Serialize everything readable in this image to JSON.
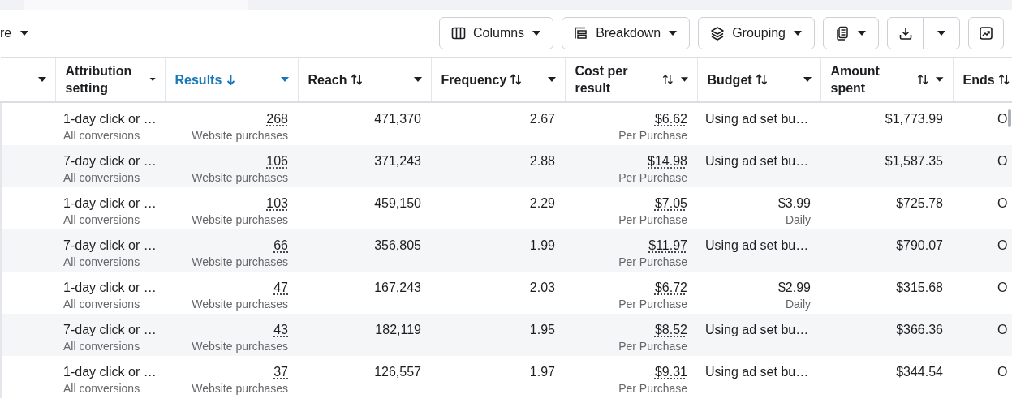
{
  "toolbar": {
    "left_menu": {
      "label": "re"
    },
    "buttons": [
      {
        "kind": "dropdown",
        "label": "Columns"
      },
      {
        "kind": "dropdown",
        "label": "Breakdown"
      },
      {
        "kind": "dropdown",
        "label": "Grouping"
      },
      {
        "kind": "dropdown"
      },
      {
        "kind": "split"
      },
      {
        "kind": "icon"
      }
    ]
  },
  "table": {
    "columns": [
      {
        "sortable": false,
        "selected": false
      },
      {
        "label": "Attribution setting",
        "sortable": false,
        "selected": false
      },
      {
        "label": "Results",
        "sortable": true,
        "selected": true
      },
      {
        "label": "Reach",
        "sortable": true,
        "selected": false
      },
      {
        "label": "Frequency",
        "sortable": true,
        "selected": false
      },
      {
        "label": "Cost per result",
        "sortable": true,
        "selected": false
      },
      {
        "label": "Budget",
        "sortable": true,
        "selected": false
      },
      {
        "label": "Amount spent",
        "sortable": true,
        "selected": false
      },
      {
        "label": "Ends",
        "sortable": true,
        "selected": false
      }
    ],
    "rows": [
      {
        "attribution": "1-day click or …",
        "attribution_sub": "All conversions",
        "results": "268",
        "results_sub": "Website purchases",
        "reach": "471,370",
        "frequency": "2.67",
        "cost": "$6.62",
        "cost_sub": "Per Purchase",
        "budget": "Using ad set bu…",
        "amount": "$1,773.99",
        "ends": "O"
      },
      {
        "attribution": "7-day click or …",
        "attribution_sub": "All conversions",
        "results": "106",
        "results_sub": "Website purchases",
        "reach": "371,243",
        "frequency": "2.88",
        "cost": "$14.98",
        "cost_sub": "Per Purchase",
        "budget": "Using ad set bu…",
        "amount": "$1,587.35",
        "ends": "O"
      },
      {
        "attribution": "1-day click or …",
        "attribution_sub": "All conversions",
        "results": "103",
        "results_sub": "Website purchases",
        "reach": "459,150",
        "frequency": "2.29",
        "cost": "$7.05",
        "cost_sub": "Per Purchase",
        "budget": "$3.99",
        "budget_sub": "Daily",
        "amount": "$725.78",
        "ends": "O"
      },
      {
        "attribution": "7-day click or …",
        "attribution_sub": "All conversions",
        "results": "66",
        "results_sub": "Website purchases",
        "reach": "356,805",
        "frequency": "1.99",
        "cost": "$11.97",
        "cost_sub": "Per Purchase",
        "budget": "Using ad set bu…",
        "amount": "$790.07",
        "ends": "O"
      },
      {
        "attribution": "1-day click or …",
        "attribution_sub": "All conversions",
        "results": "47",
        "results_sub": "Website purchases",
        "reach": "167,243",
        "frequency": "2.03",
        "cost": "$6.72",
        "cost_sub": "Per Purchase",
        "budget": "$2.99",
        "budget_sub": "Daily",
        "amount": "$315.68",
        "ends": "O"
      },
      {
        "attribution": "7-day click or …",
        "attribution_sub": "All conversions",
        "results": "43",
        "results_sub": "Website purchases",
        "reach": "182,119",
        "frequency": "1.95",
        "cost": "$8.52",
        "cost_sub": "Per Purchase",
        "budget": "Using ad set bu…",
        "amount": "$366.36",
        "ends": "O"
      },
      {
        "attribution": "1-day click or …",
        "attribution_sub": "All conversions",
        "results": "37",
        "results_sub": "Website purchases",
        "reach": "126,557",
        "frequency": "1.97",
        "cost": "$9.31",
        "cost_sub": "Per Purchase",
        "budget": "Using ad set bu…",
        "amount": "$344.54",
        "ends": "O"
      }
    ]
  }
}
